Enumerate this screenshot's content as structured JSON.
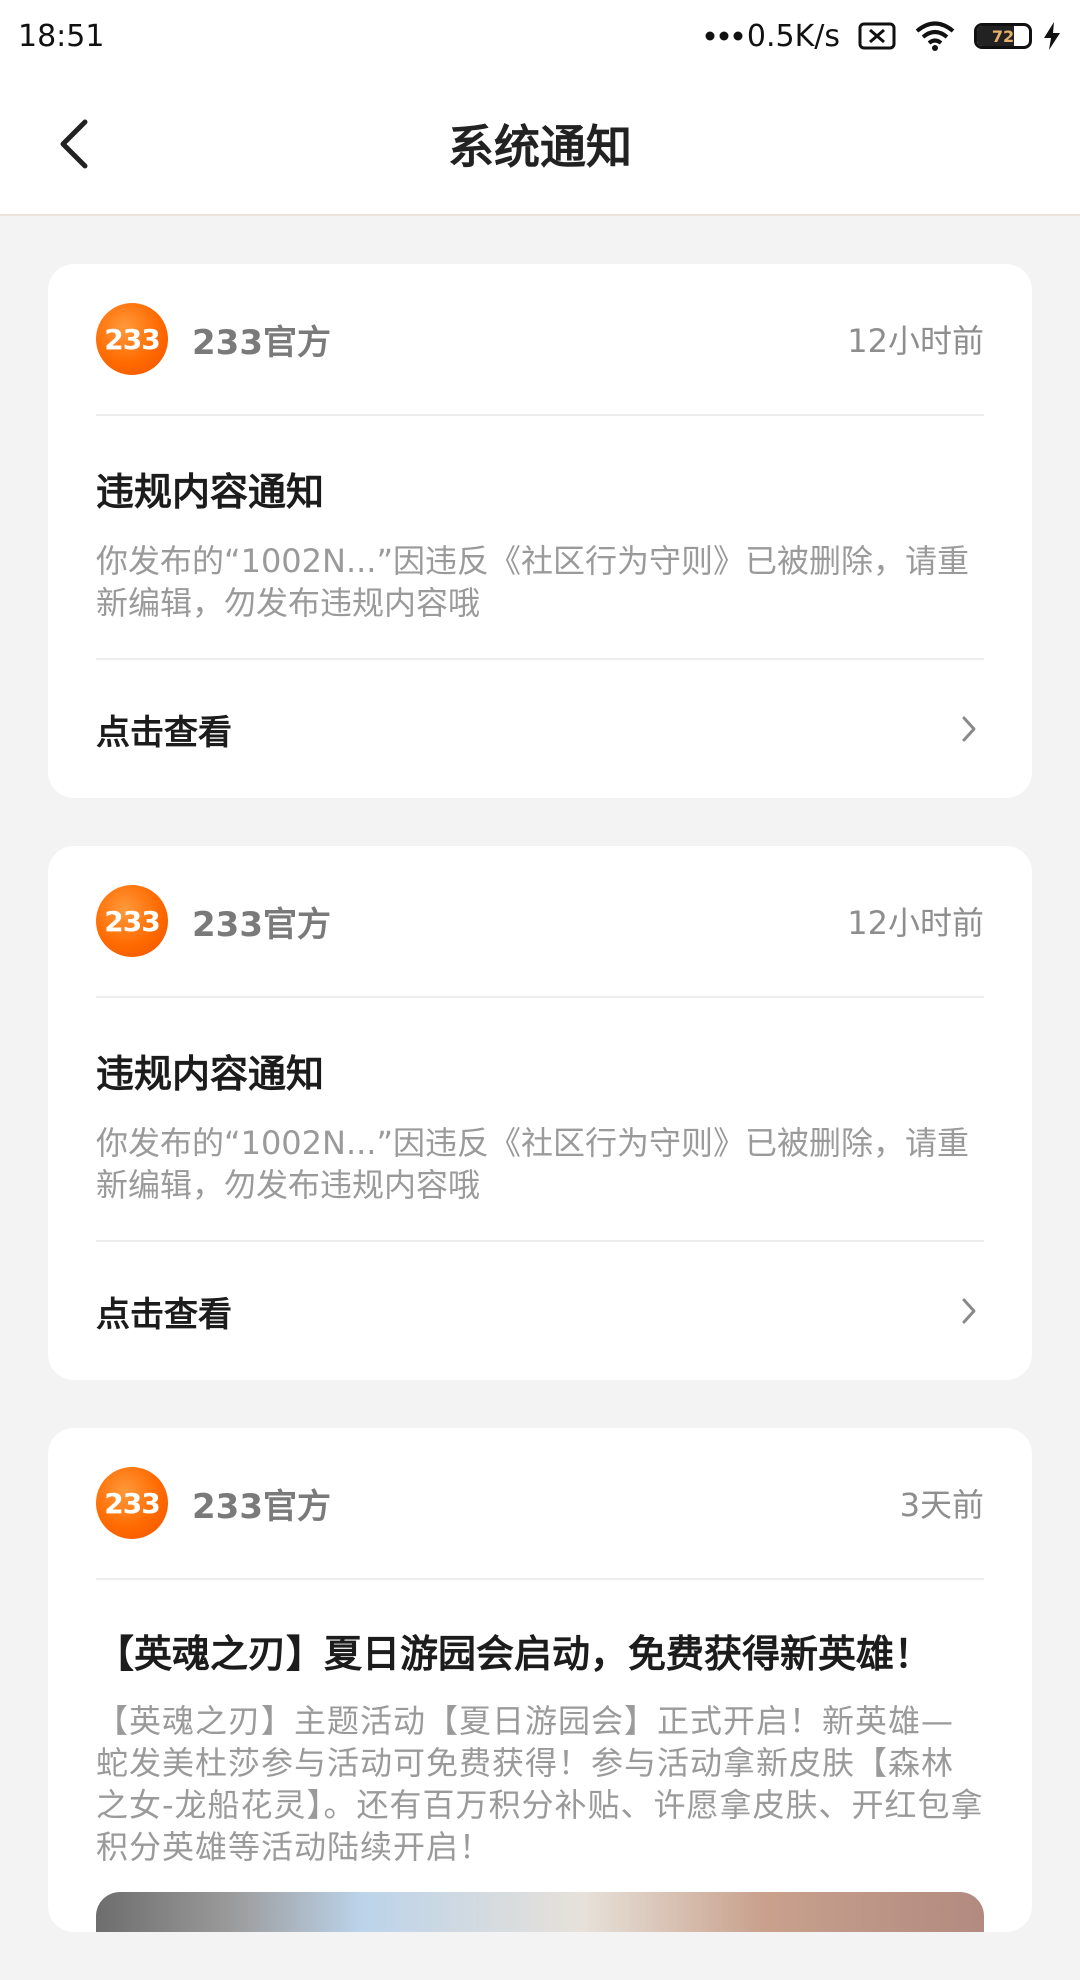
{
  "status_bar": {
    "time": "18:51",
    "net_speed": "0.5K/s",
    "battery_level": 72,
    "battery_text": "72"
  },
  "header": {
    "title": "系统通知",
    "back_icon": "chevron-left-icon"
  },
  "notifications": [
    {
      "avatar_text": "233",
      "sender": "233官方",
      "time": "12小时前",
      "title": "违规内容通知",
      "text": "你发布的“1002N...”因违反《社区行为守则》已被删除，请重新编辑，勿发布违规内容哦",
      "action_label": "点击查看"
    },
    {
      "avatar_text": "233",
      "sender": "233官方",
      "time": "12小时前",
      "title": "违规内容通知",
      "text": "你发布的“1002N...”因违反《社区行为守则》已被删除，请重新编辑，勿发布违规内容哦",
      "action_label": "点击查看"
    },
    {
      "avatar_text": "233",
      "sender": "233官方",
      "time": "3天前",
      "title": "【英魂之刃】夏日游园会启动，免费获得新英雄！",
      "text": "【英魂之刃】主题活动【夏日游园会】正式开启！新英雄—蛇发美杜莎参与活动可免费获得！参与活动拿新皮肤【森林之女-龙船花灵】。还有百万积分补贴、许愿拿皮肤、开红包拿积分英雄等活动陆续开启！"
    }
  ],
  "colors": {
    "brand_orange": "#ff6a00",
    "background": "#f3f3f3",
    "card": "#ffffff"
  }
}
